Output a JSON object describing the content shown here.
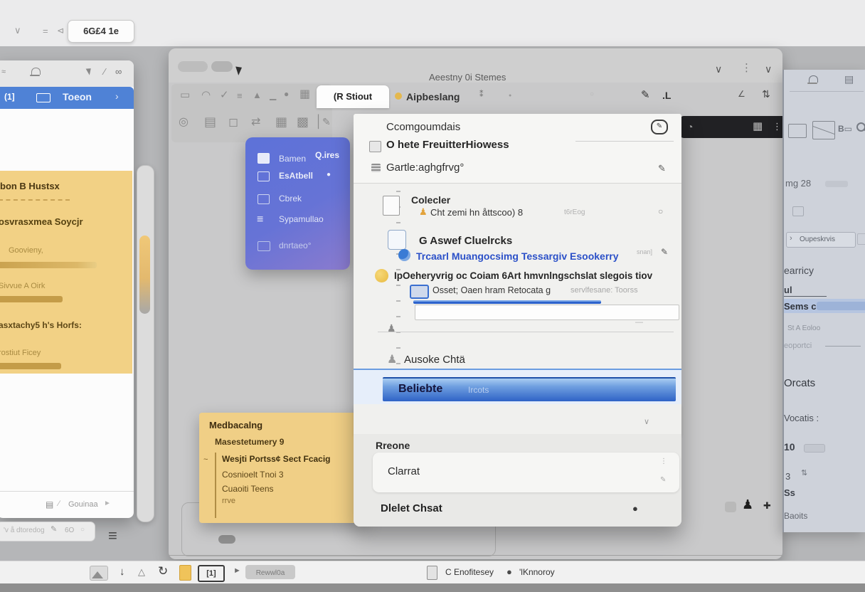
{
  "icons": {
    "chevron_down": "∨",
    "dots_vertical": "⋮",
    "pencil": "✎",
    "circle": "○",
    "dot": "●",
    "asterisk": "⁑",
    "infinity": "∞",
    "menu": "≡",
    "chevron_right": "›",
    "history": "◔",
    "grid": "▦",
    "grid_alt": "▤",
    "person": "♟",
    "arrow_down": "↓",
    "triangle_up": "△",
    "recycle": "↻",
    "flag": "►",
    "equals": "=",
    "tri_left": "⊲",
    "dash": "—",
    "angle": "∠",
    "sort": "⇅",
    "plus": "✚",
    "wave": "≈",
    "slash": "∕"
  },
  "top_strip": {
    "chip_label": "6G£4 1e"
  },
  "left_window": {
    "tab_label": "Toeon",
    "tab_badge": "(1]",
    "footer_label": "Gouinaa",
    "note_chip": "'v å dtoredog",
    "note_chip_value": "6O",
    "yellow_panel": {
      "heading": "bon B Hustsx",
      "subheading": "osvrasxmea Soycjr",
      "fields": [
        {
          "label": "Goovieny,"
        },
        {
          "label": "Sivvue A Oirk"
        },
        {
          "label": "asxtachy5 h's Horfs:"
        },
        {
          "label": "rostiut Ficey"
        }
      ]
    }
  },
  "main_window": {
    "title": "Aeestny 0i Stemes",
    "tabs": [
      {
        "label": "(R Stiout"
      },
      {
        "label": "Aipbeslang"
      }
    ],
    "toolbar_row1": [
      "▭",
      "◠",
      "✓",
      "≡",
      "▲",
      "▁",
      "●",
      "▦"
    ],
    "toolbar_row2": [
      "◎",
      "▤",
      "◻",
      "⇄",
      "▦",
      "▩",
      "│",
      "✎"
    ],
    "tab_extra": ".L"
  },
  "blue_panel": {
    "badge": "Q.ires",
    "items": [
      {
        "label": "Bamen"
      },
      {
        "label": "EsAtbell"
      },
      {
        "label": "Cbrek"
      },
      {
        "label": "Sypamullao"
      },
      {
        "label": "dnrtaeo°"
      }
    ]
  },
  "sticky_note": {
    "title": "Medbacalng",
    "subtitle": "Masestetumery 9",
    "lines": [
      "Wesjti Portss¢ Sect Fcacig",
      "Cosnioelt Tnoi 3",
      "Cuaoiti Teens",
      "rrve"
    ]
  },
  "popup": {
    "header_items": [
      {
        "label": "Ccomgoumdais"
      },
      {
        "label": "O hete FreuitterHiowess"
      },
      {
        "label": "Gartle:aghgfrvg°"
      }
    ],
    "groups": {
      "collection_title": "Colecler",
      "collection_sub": "Cht zemi hn åttscoo) 8",
      "collection_meta": "t6rEog",
      "answer_title": "G Aswef Cluelrcks",
      "answer_link": "Trcaarl Muangocsimg Tessargiv Esookerry",
      "answer_meta": "snan]",
      "identify_title": "IpOeheryvrig oc Coiam 6Art hmvnlngschslat slegois tiov",
      "identify_sub": "Osset; Oaen hram Retocata g",
      "identify_meta": "servlfesane: Toorss"
    },
    "rows": {
      "about": "Ausoke Chtä",
      "highlight": "Beliebte",
      "highlight_meta": "Ircots",
      "rename": "Rreone",
      "cart": "Clarrat",
      "delete": "Dlelet Chsat"
    }
  },
  "right_sidebar": {
    "size_label": "mg 28",
    "questions_button": "Oupeskrvis",
    "search_label": "earricy",
    "ui_label": "ul",
    "items_label": "Sems c",
    "sub_label": "St A Eoloo",
    "report_label": "eoportci",
    "orcats_label": "Orcats",
    "vocatis_label": "Vocatis :",
    "count1": "10",
    "count2": "3",
    "ss_label": "Ss",
    "bottom_label": "Baoits"
  },
  "taskbar": {
    "chip": "Rewwl0a",
    "badge1": "[1]",
    "status_left": "C Enofitesey",
    "status_right": "'lKnnoroy"
  }
}
